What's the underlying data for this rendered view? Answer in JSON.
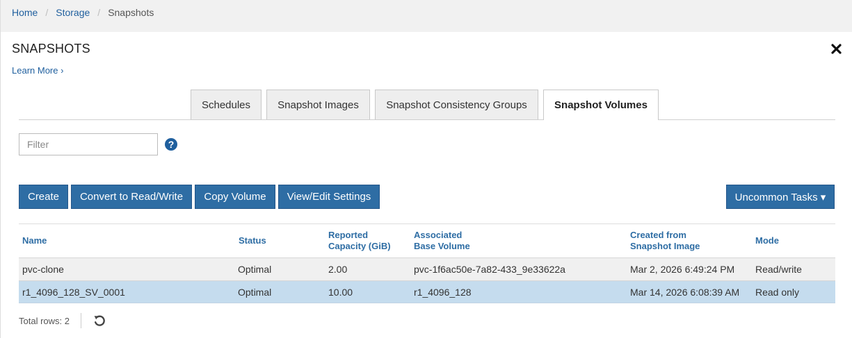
{
  "breadcrumb": {
    "items": [
      "Home",
      "Storage"
    ],
    "separator": "/",
    "current": "Snapshots"
  },
  "page": {
    "title": "SNAPSHOTS",
    "learn_more": "Learn More ›"
  },
  "tabs": [
    {
      "label": "Schedules"
    },
    {
      "label": "Snapshot Images"
    },
    {
      "label": "Snapshot Consistency Groups"
    },
    {
      "label": "Snapshot Volumes"
    }
  ],
  "filter": {
    "placeholder": "Filter",
    "value": ""
  },
  "help_glyph": "?",
  "toolbar": {
    "create": "Create",
    "convert": "Convert to Read/Write",
    "copy": "Copy Volume",
    "view_edit": "View/Edit Settings",
    "uncommon": "Uncommon Tasks ▾"
  },
  "table": {
    "columns": {
      "name": "Name",
      "status": "Status",
      "capacity_1": "Reported",
      "capacity_2": "Capacity (GiB)",
      "base_1": "Associated",
      "base_2": "Base Volume",
      "created_1": "Created from",
      "created_2": "Snapshot Image",
      "mode": "Mode"
    },
    "rows": [
      {
        "name": "pvc-clone",
        "status": "Optimal",
        "capacity": "2.00",
        "base": "pvc-1f6ac50e-7a82-433_9e33622a",
        "created": "Mar 2, 2026 6:49:24 PM",
        "mode": "Read/write"
      },
      {
        "name": "r1_4096_128_SV_0001",
        "status": "Optimal",
        "capacity": "10.00",
        "base": "r1_4096_128",
        "created": "Mar 14, 2026 6:08:39 AM",
        "mode": "Read only"
      }
    ]
  },
  "footer": {
    "total_rows": "Total rows: 2"
  },
  "colors": {
    "accent": "#2e6da4",
    "link": "#1f5f9e",
    "selected_row": "#c5dcee"
  }
}
